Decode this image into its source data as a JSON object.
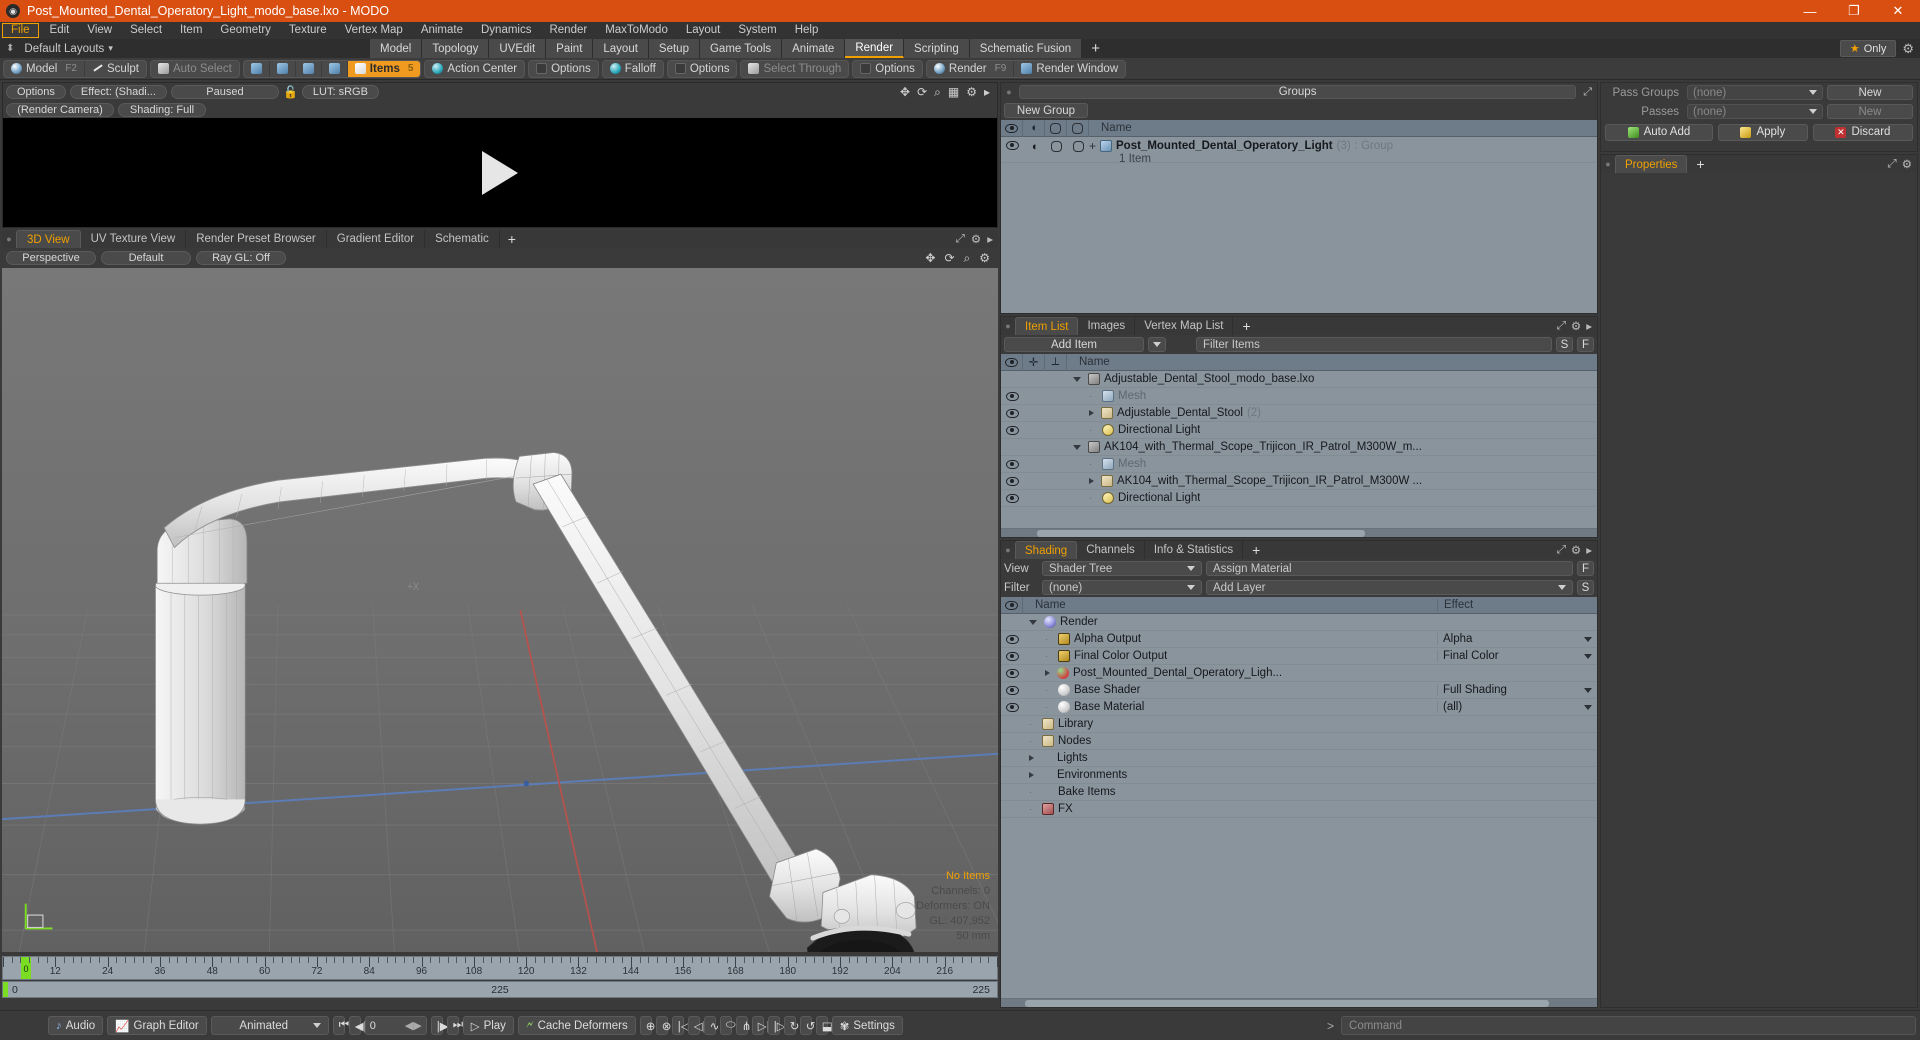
{
  "window": {
    "title": "Post_Mounted_Dental_Operatory_Light_modo_base.lxo - MODO",
    "minimize": "—",
    "maximize": "❐",
    "close": "✕"
  },
  "menu": {
    "items": [
      "File",
      "Edit",
      "View",
      "Select",
      "Item",
      "Geometry",
      "Texture",
      "Vertex Map",
      "Animate",
      "Dynamics",
      "Render",
      "MaxToModo",
      "Layout",
      "System",
      "Help"
    ],
    "active": "File"
  },
  "layout_row": {
    "default_layouts": "Default Layouts",
    "tabs": [
      "Model",
      "Topology",
      "UVEdit",
      "Paint",
      "Layout",
      "Setup",
      "Game Tools",
      "Animate",
      "Render",
      "Scripting",
      "Schematic Fusion"
    ],
    "selected_tab": "Render",
    "add_tab": "+",
    "only_button": "Only",
    "star_icon": "star-icon",
    "gear_icon": "gear-icon"
  },
  "modebar": {
    "model": "Model",
    "model_key": "F2",
    "sculpt": "Sculpt",
    "auto_select": "Auto Select",
    "items": "Items",
    "items_key": "5",
    "action_center": "Action Center",
    "options1": "Options",
    "falloff": "Falloff",
    "options2": "Options",
    "select_through": "Select Through",
    "options3": "Options",
    "render": "Render",
    "render_key": "F9",
    "render_window": "Render Window"
  },
  "render_preview": {
    "options": "Options",
    "effect": "Effect: (Shadi...",
    "status": "Paused",
    "lock_icon": "unlock-icon",
    "lut": "LUT: sRGB",
    "camera": "(Render Camera)",
    "shading": "Shading: Full",
    "play_icon": "play-icon",
    "toolbar_icons": [
      "move-icon",
      "rotate-icon",
      "zoom-icon",
      "grid-icon",
      "gear-icon",
      "arrow-icon"
    ]
  },
  "viewport": {
    "tabs": [
      "3D View",
      "UV Texture View",
      "Render Preset Browser",
      "Gradient Editor",
      "Schematic"
    ],
    "selected_tab": "3D View",
    "add_tab": "+",
    "view_mode": "Perspective",
    "preset": "Default",
    "raygl": "Ray GL: Off",
    "stats": {
      "no_items": "No Items",
      "channels": "Channels: 0",
      "deformers": "Deformers: ON",
      "gl": "GL: 407,952",
      "scale": "50 mm"
    },
    "axis_labels": {
      "x": "+X"
    }
  },
  "groups_panel": {
    "title": "Groups",
    "new_group": "New Group",
    "columns": [
      "eye",
      "link",
      "shape1",
      "shape2",
      "Name"
    ],
    "rows": [
      {
        "name": "Post_Mounted_Dental_Operatory_Light",
        "count": "(3)",
        "suffix": ": Group",
        "sub": "1 Item",
        "expand": "+"
      }
    ]
  },
  "item_list": {
    "tabs": [
      "Item List",
      "Images",
      "Vertex Map List"
    ],
    "selected_tab": "Item List",
    "add_tab": "+",
    "add_item": "Add Item",
    "filter_placeholder": "Filter Items",
    "filter_s": "S",
    "filter_f": "F",
    "column_name": "Name",
    "rows": [
      {
        "label": "Adjustable_Dental_Stool_modo_base.lxo",
        "icon": "film-icon",
        "indent": 0,
        "expanded": true,
        "eye": false,
        "dim": false
      },
      {
        "label": "Mesh",
        "icon": "mesh-icon",
        "indent": 1,
        "expanded": false,
        "eye": true,
        "dim": true
      },
      {
        "label": "Adjustable_Dental_Stool",
        "count": "(2)",
        "icon": "folder-icon",
        "indent": 1,
        "expanded": false,
        "collapsed_arrow": true,
        "eye": true,
        "dim": false
      },
      {
        "label": "Directional Light",
        "icon": "light-icon",
        "indent": 1,
        "expanded": false,
        "eye": true,
        "dim": false
      },
      {
        "label": "AK104_with_Thermal_Scope_Trijicon_IR_Patrol_M300W_m...",
        "icon": "film-icon",
        "indent": 0,
        "expanded": true,
        "eye": false,
        "dim": false
      },
      {
        "label": "Mesh",
        "icon": "mesh-icon",
        "indent": 1,
        "expanded": false,
        "eye": true,
        "dim": true
      },
      {
        "label": "AK104_with_Thermal_Scope_Trijicon_IR_Patrol_M300W ...",
        "icon": "folder-icon",
        "indent": 1,
        "collapsed_arrow": true,
        "eye": true,
        "dim": false
      },
      {
        "label": "Directional Light",
        "icon": "light-icon",
        "indent": 1,
        "expanded": false,
        "eye": true,
        "dim": false
      }
    ]
  },
  "shading_panel": {
    "tabs": [
      "Shading",
      "Channels",
      "Info & Statistics"
    ],
    "selected_tab": "Shading",
    "add_tab": "+",
    "view_label": "View",
    "view_value": "Shader Tree",
    "assign_material": "Assign Material",
    "assign_f": "F",
    "filter_label": "Filter",
    "filter_value": "(none)",
    "add_layer": "Add Layer",
    "add_layer_s": "S",
    "col_name": "Name",
    "col_effect": "Effect",
    "rows": [
      {
        "label": "Render",
        "icon": "render-ball-icon",
        "indent": 0,
        "expanded": true,
        "eye": false,
        "effect": ""
      },
      {
        "label": "Alpha Output",
        "icon": "image-icon",
        "indent": 1,
        "eye": true,
        "effect": "Alpha",
        "has_dropdown": true
      },
      {
        "label": "Final Color Output",
        "icon": "image-icon",
        "indent": 1,
        "eye": true,
        "effect": "Final Color",
        "has_dropdown": true
      },
      {
        "label": "Post_Mounted_Dental_Operatory_Ligh...",
        "icon": "material-sphere-icon",
        "indent": 1,
        "collapsed_arrow": true,
        "eye": true,
        "effect": ""
      },
      {
        "label": "Base Shader",
        "icon": "shader-icon",
        "indent": 1,
        "eye": true,
        "effect": "Full Shading",
        "has_dropdown": true
      },
      {
        "label": "Base Material",
        "icon": "shader-icon",
        "indent": 1,
        "eye": true,
        "effect": "(all)",
        "has_dropdown": true
      },
      {
        "label": "Library",
        "icon": "folder-icon",
        "indent": 0,
        "eye": false,
        "effect": ""
      },
      {
        "label": "Nodes",
        "icon": "folder-icon",
        "indent": 0,
        "eye": false,
        "effect": ""
      },
      {
        "label": "Lights",
        "icon": "none",
        "indent": 0,
        "collapsed_arrow": true,
        "eye": false,
        "effect": ""
      },
      {
        "label": "Environments",
        "icon": "none",
        "indent": 0,
        "collapsed_arrow": true,
        "eye": false,
        "effect": ""
      },
      {
        "label": "Bake Items",
        "icon": "none",
        "indent": 0,
        "eye": false,
        "effect": ""
      },
      {
        "label": "FX",
        "icon": "fx-icon",
        "indent": 0,
        "eye": false,
        "effect": ""
      }
    ]
  },
  "properties_panel": {
    "pass_groups_label": "Pass Groups",
    "pass_groups_value": "(none)",
    "passes_label": "Passes",
    "passes_value": "(none)",
    "new_button": "New",
    "new_button2": "New",
    "auto_add": "Auto Add",
    "apply": "Apply",
    "discard": "Discard",
    "tab_properties": "Properties",
    "add_tab": "+"
  },
  "timeline": {
    "ticks": [
      "12",
      "24",
      "36",
      "48",
      "60",
      "72",
      "84",
      "96",
      "108",
      "120",
      "132",
      "144",
      "156",
      "168",
      "180",
      "192",
      "204",
      "216"
    ],
    "playhead": "0",
    "range_start": "0",
    "range_center": "225",
    "range_end": "225"
  },
  "bottom_bar": {
    "audio": "Audio",
    "graph_editor": "Graph Editor",
    "animated": "Animated",
    "frame_value": "0",
    "play": "Play",
    "cache_deformers": "Cache Deformers",
    "settings": "Settings",
    "command_placeholder": "Command",
    "command_prompt": ">"
  },
  "colors": {
    "title_bar": "#d94f11",
    "accent": "#f0a000",
    "panel_bg": "#3a3a3a",
    "list_bg": "#8a949d",
    "header_bg": "#6e7b88",
    "green": "#7bdd22"
  }
}
